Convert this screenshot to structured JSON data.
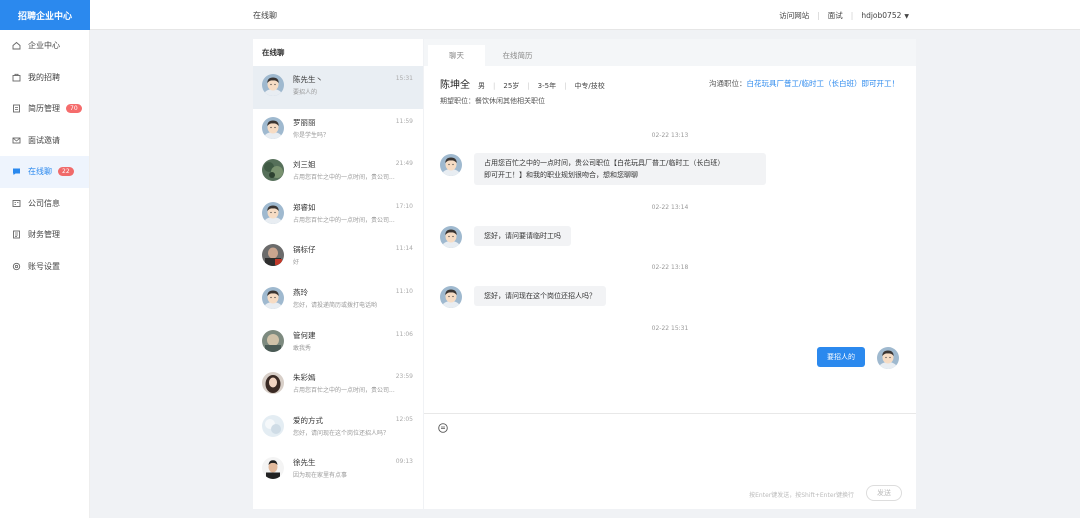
{
  "brand": "招聘企业中心",
  "header": {
    "title": "在线聊",
    "links": [
      "访问网站",
      "面试"
    ],
    "user": "hdjob0752"
  },
  "sidebar": {
    "items": [
      {
        "label": "企业中心",
        "icon": "home-icon"
      },
      {
        "label": "我的招聘",
        "icon": "briefcase-icon"
      },
      {
        "label": "简历管理",
        "icon": "document-icon",
        "badge": "70"
      },
      {
        "label": "面试邀请",
        "icon": "mail-icon"
      },
      {
        "label": "在线聊",
        "icon": "chat-icon",
        "badge": "22",
        "active": true
      },
      {
        "label": "公司信息",
        "icon": "company-icon"
      },
      {
        "label": "财务管理",
        "icon": "finance-icon"
      },
      {
        "label": "账号设置",
        "icon": "gear-icon"
      }
    ]
  },
  "conversations": {
    "title": "在线聊",
    "items": [
      {
        "name": "陈先生丶",
        "time": "15:31",
        "preview": "要招人的",
        "avatar": "cartoon",
        "active": true
      },
      {
        "name": "罗丽丽",
        "time": "11:59",
        "preview": "你是学生吗？",
        "avatar": "cartoon"
      },
      {
        "name": "刘三姐",
        "time": "21:49",
        "preview": "占用您百忙之中的一点时间，贵公司...",
        "avatar": "photo-green"
      },
      {
        "name": "郑睿如",
        "time": "17:10",
        "preview": "占用您百忙之中的一点时间，贵公司...",
        "avatar": "cartoon"
      },
      {
        "name": "锅标仔",
        "time": "11:14",
        "preview": "好",
        "avatar": "photo-red"
      },
      {
        "name": "燕玲",
        "time": "11:10",
        "preview": "您好，请投递简历或拨打电话哟",
        "avatar": "cartoon"
      },
      {
        "name": "管何建",
        "time": "11:06",
        "preview": "敢我秀",
        "avatar": "photo-gray"
      },
      {
        "name": "朱彩嫣",
        "time": "23:59",
        "preview": "占用您百忙之中的一点时间，贵公司...",
        "avatar": "photo-woman"
      },
      {
        "name": "爱的方式",
        "time": "12:05",
        "preview": "您好，请问现在这个岗位还招人吗？",
        "avatar": "photo-light"
      },
      {
        "name": "徐先生",
        "time": "09:13",
        "preview": "因为现在家里有点事",
        "avatar": "photo-man"
      }
    ]
  },
  "chat": {
    "tabs": [
      "聊天",
      "在线简历"
    ],
    "contact": {
      "name": "陈坤全",
      "gender": "男",
      "age": "25岁",
      "experience": "3-5年",
      "education": "中专/技校"
    },
    "expect_label": "期望职位：",
    "expect_value": "餐饮休闲其他相关职位",
    "position_label": "沟通职位：",
    "position_value": "白花玩具厂普工/临时工（长白班）即可开工！",
    "messages": [
      {
        "stamp": "02-22 13:13",
        "side": "left",
        "text_line1": "占用您百忙之中的一点时间，贵公司职位【白花玩具厂普工/临时工（长白班）",
        "text_line2": "即可开工！】和我的职业规划很吻合，想和您聊聊"
      },
      {
        "stamp": "02-22 13:14",
        "side": "left",
        "text": "您好，请问要请临时工吗"
      },
      {
        "stamp": "02-22 13:18",
        "side": "left",
        "text": "您好，请问现在这个岗位还招人吗？"
      },
      {
        "stamp": "02-22 15:31",
        "side": "right",
        "text": "要招人的"
      }
    ],
    "hint": "按Enter键发送，按Shift+Enter键换行",
    "send_label": "发送"
  },
  "colors": {
    "accent": "#2b89ee",
    "badge": "#f56c6c"
  }
}
